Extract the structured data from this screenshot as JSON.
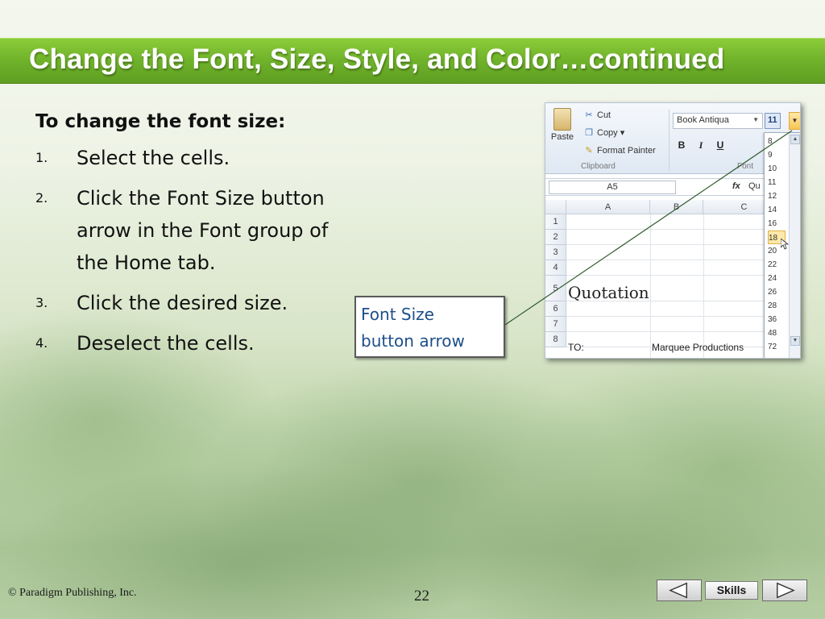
{
  "slide": {
    "title": "Change the Font, Size, Style, and Color…continued",
    "heading": "To change the font size:",
    "steps": [
      {
        "num": "1.",
        "lines": [
          "Select the cells."
        ]
      },
      {
        "num": "2.",
        "lines": [
          "Click the Font Size button",
          "arrow in the Font group of",
          "the Home tab."
        ]
      },
      {
        "num": "3.",
        "lines": [
          "Click the desired size."
        ]
      },
      {
        "num": "4.",
        "lines": [
          "Deselect the cells."
        ]
      }
    ],
    "callout": [
      "Font Size",
      "button arrow"
    ]
  },
  "excel": {
    "paste_label": "Paste",
    "cut_label": "Cut",
    "copy_label": "Copy",
    "format_painter_label": "Format Painter",
    "clipboard_group": "Clipboard",
    "font_group": "Font",
    "font_name": "Book Antiqua",
    "font_size": "11",
    "bold": "B",
    "italic": "I",
    "underline": "U",
    "name_box": "A5",
    "fx": "fx",
    "formula_value": "Qu",
    "columns": [
      "A",
      "B",
      "C"
    ],
    "rows": [
      "1",
      "2",
      "3",
      "4",
      "5",
      "6",
      "7",
      "8"
    ],
    "quotation": "Quotation",
    "to_label": "TO:",
    "marquee": "Marquee Productions",
    "font_sizes": [
      "8",
      "9",
      "10",
      "11",
      "12",
      "14",
      "16",
      "18",
      "20",
      "22",
      "24",
      "26",
      "28",
      "36",
      "48",
      "72"
    ],
    "highlighted_size": "18"
  },
  "footer": {
    "copyright": "© Paradigm Publishing, Inc.",
    "page": "22",
    "skills": "Skills"
  },
  "colors": {
    "title_bar": "#6fb22a",
    "callout_text": "#1c4f8a",
    "leader_line": "#2f5a2a"
  }
}
